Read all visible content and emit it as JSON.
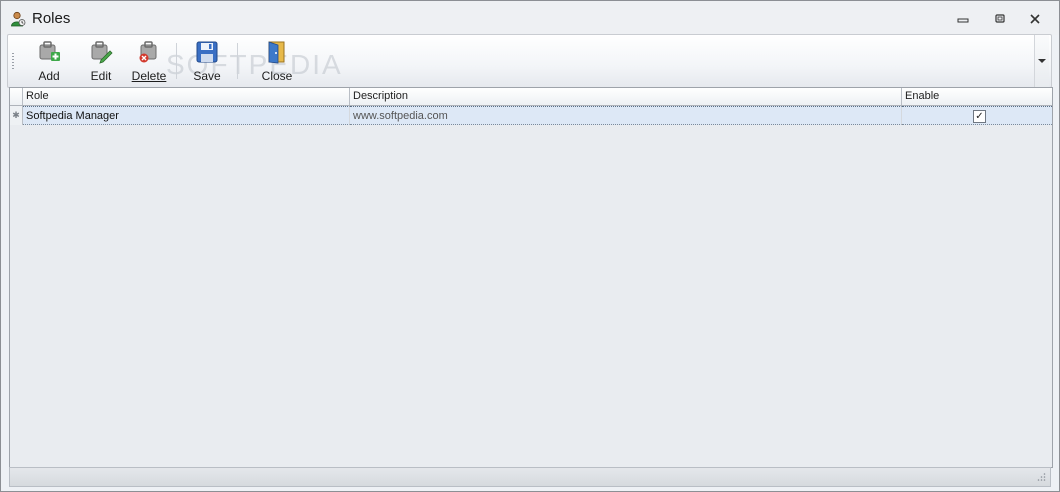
{
  "window": {
    "title": "Roles",
    "title_icon": "user-roles-icon"
  },
  "window_controls": {
    "minimize_icon": "minimize-icon",
    "restore_icon": "restore-icon",
    "close_icon": "close-icon"
  },
  "toolbar": {
    "items": [
      {
        "label": "Add",
        "icon": "add-role-icon"
      },
      {
        "label": "Edit",
        "icon": "edit-role-icon"
      },
      {
        "label": "Delete",
        "icon": "delete-role-icon"
      },
      {
        "label": "Save",
        "icon": "save-icon"
      },
      {
        "label": "Close",
        "icon": "exit-door-icon"
      }
    ],
    "watermark": "SOFTPEDIA",
    "overflow_icon": "chevron-down-icon"
  },
  "grid": {
    "columns": [
      "Role",
      "Description",
      "Enable"
    ],
    "rows": [
      {
        "indicator": "✱",
        "role": "Softpedia Manager",
        "description": "www.softpedia.com",
        "enable": true
      }
    ]
  },
  "colors": {
    "accent": "#dde8f6",
    "background": "#eef1f5"
  }
}
